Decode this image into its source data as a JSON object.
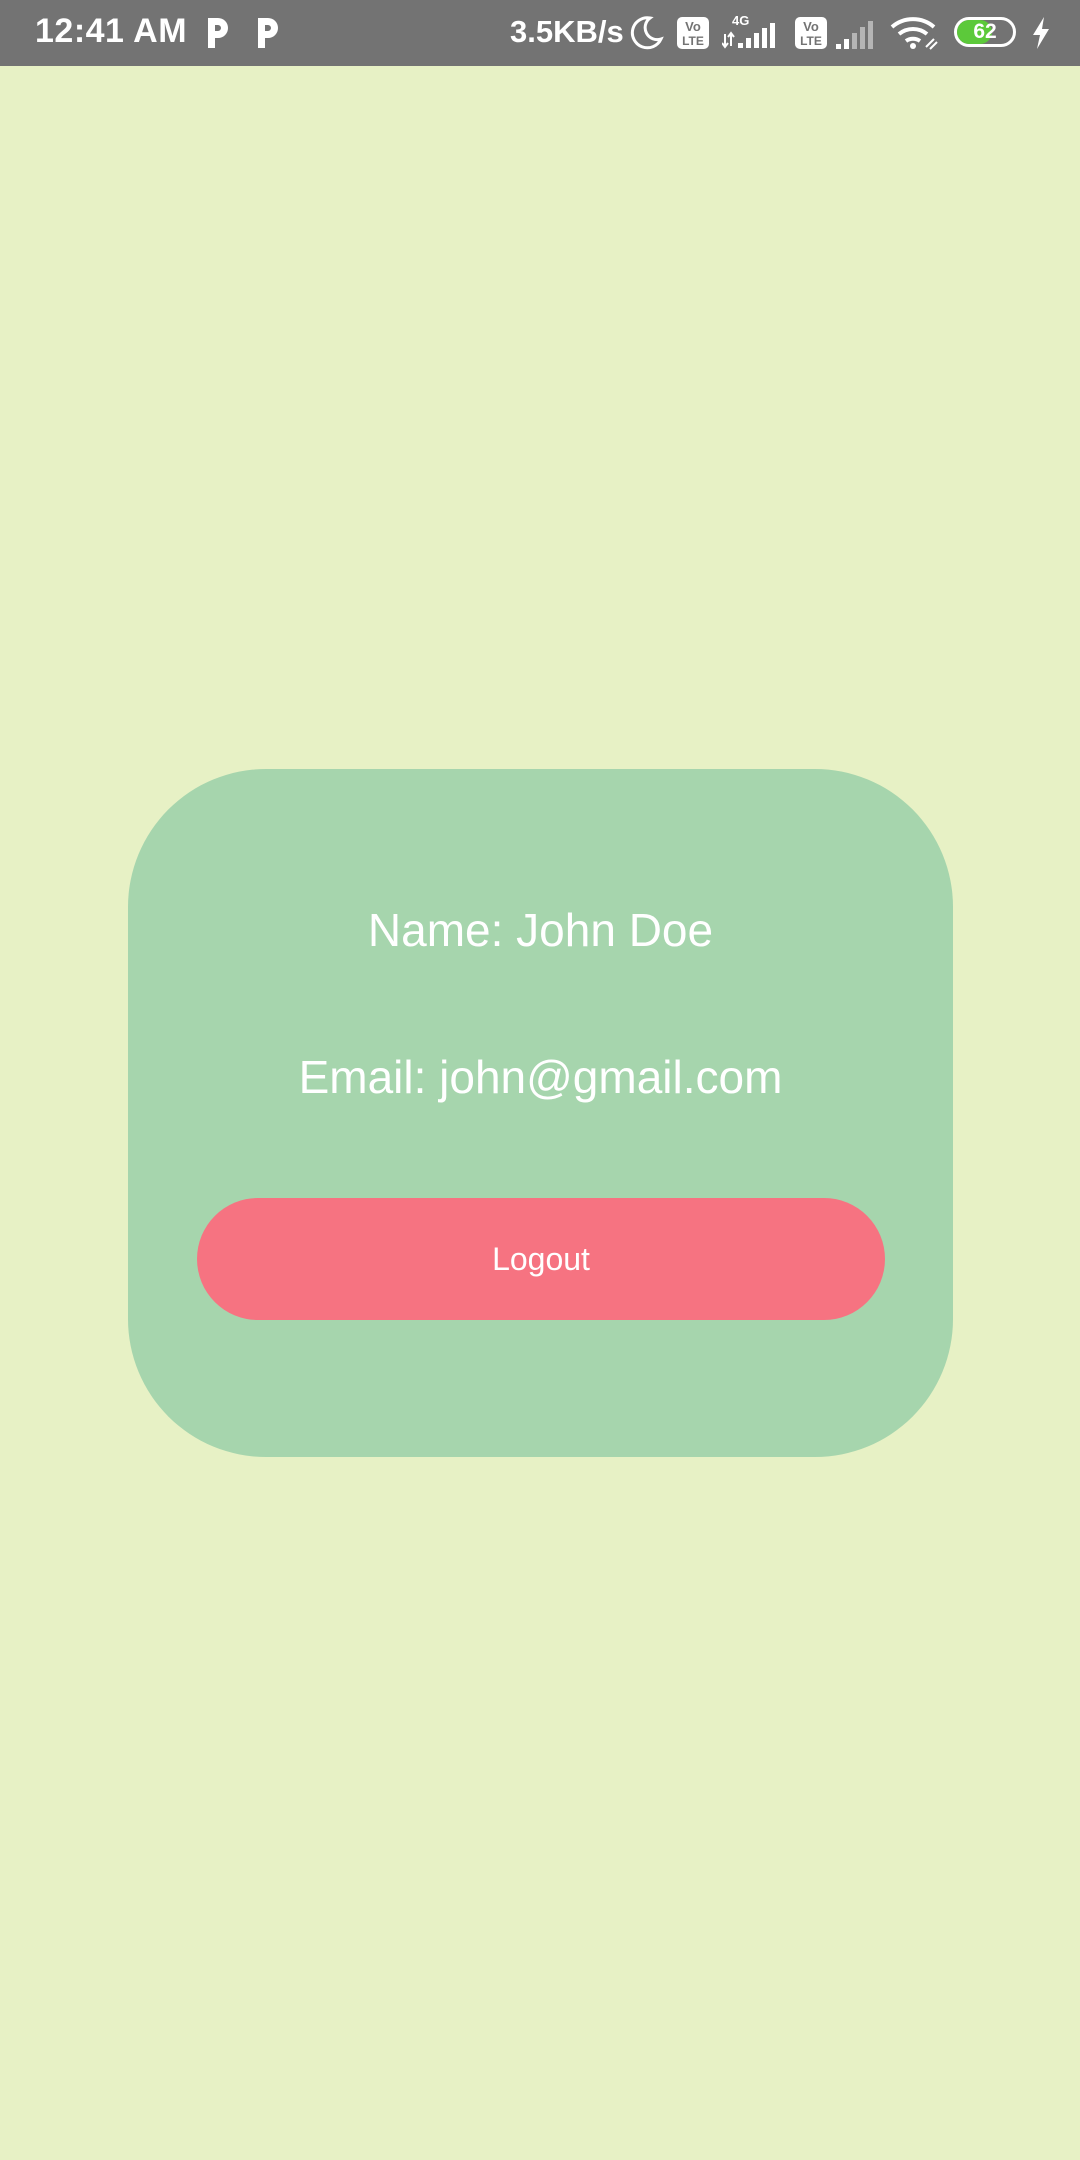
{
  "status_bar": {
    "time": "12:41 AM",
    "network_speed": "3.5KB/s",
    "network_type": "4G",
    "volte_label_top": "Vo",
    "volte_label_bottom": "LTE",
    "battery_level": "62",
    "icons": [
      "p-app-icon",
      "p-app-icon",
      "moon-icon",
      "volte-icon",
      "signal-icon",
      "volte-icon",
      "signal-icon",
      "wifi-icon",
      "battery-icon",
      "charging-icon"
    ]
  },
  "profile": {
    "name_text": "Name: John Doe",
    "email_text": "Email: john@gmail.com",
    "logout_label": "Logout"
  },
  "colors": {
    "background": "#e7f1c5",
    "card": "#a6d5ad",
    "logout_button": "#f67381",
    "status_bar": "#737373",
    "battery_fill": "#5cc93a"
  }
}
